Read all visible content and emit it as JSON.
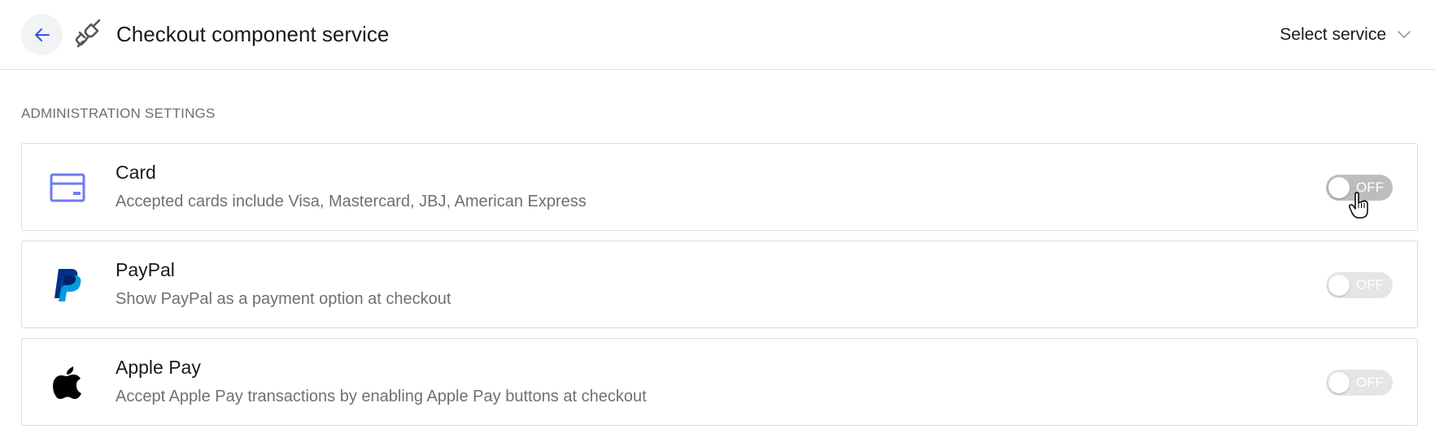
{
  "header": {
    "title": "Checkout component service",
    "service_select_label": "Select service",
    "back_icon": "arrow-left-icon",
    "service_icon": "plug-icon",
    "accent_color": "#3d4fe6"
  },
  "section": {
    "heading": "ADMINISTRATION SETTINGS"
  },
  "payment_methods": [
    {
      "title": "Card",
      "description": "Accepted cards include Visa, Mastercard, JBJ, American Express",
      "icon": "credit-card-icon",
      "toggle_state": "OFF"
    },
    {
      "title": "PayPal",
      "description": "Show PayPal as a payment option at checkout",
      "icon": "paypal-icon",
      "toggle_state": "OFF"
    },
    {
      "title": "Apple Pay",
      "description": "Accept Apple Pay transactions by enabling Apple Pay buttons at checkout",
      "icon": "apple-icon",
      "toggle_state": "OFF"
    }
  ],
  "colors": {
    "toggle_hover": "#bdbdbd",
    "toggle_off": "#e5e5e5",
    "card_icon": "#6f7bf0",
    "paypal_dark": "#003087",
    "paypal_light": "#009cde"
  }
}
